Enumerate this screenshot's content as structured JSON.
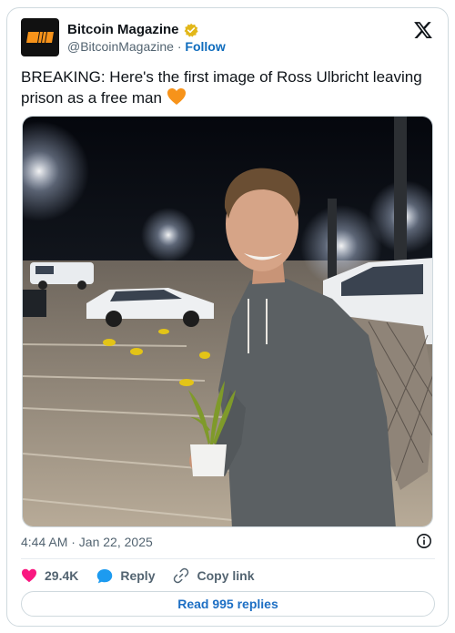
{
  "account": {
    "name": "Bitcoin Magazine",
    "handle": "@BitcoinMagazine",
    "separator": "·",
    "follow_label": "Follow"
  },
  "tweet": {
    "text": "BREAKING: Here's the first image of Ross Ulbricht leaving prison as a free man",
    "emoji": "heart-emoji"
  },
  "photo": {
    "icon": "photo"
  },
  "meta": {
    "timestamp": "4:44 AM · Jan 22, 2025"
  },
  "actions": {
    "likes": "29.4K",
    "reply_label": "Reply",
    "copy_link_label": "Copy link"
  },
  "replies_button": "Read 995 replies",
  "colors": {
    "like_pink": "#f91880",
    "reply_blue": "#1d9bf0",
    "link_blue": "#1d6fc4",
    "verified_gold": "#e2b719",
    "heart_orange": "#f7931a"
  }
}
